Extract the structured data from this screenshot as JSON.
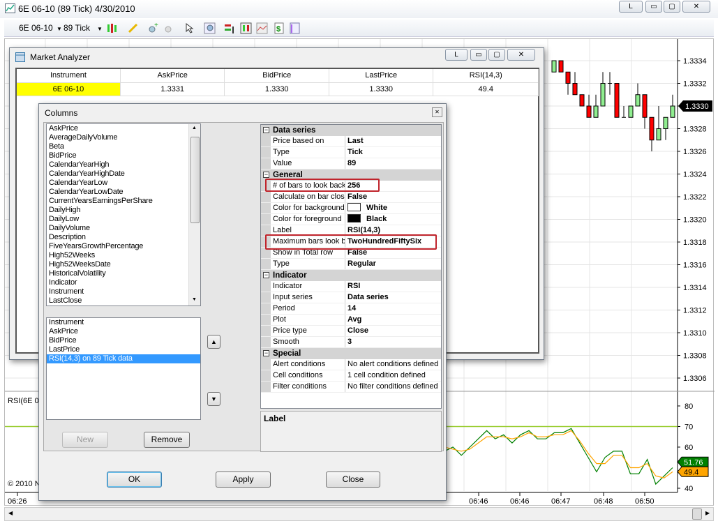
{
  "window": {
    "title": "6E 06-10 (89 Tick)  4/30/2010",
    "controls": [
      "L",
      "▭",
      "▢",
      "✕"
    ]
  },
  "toolbar": {
    "instrument": "6E 06-10",
    "interval": "89 Tick",
    "icons": [
      "chart-style-icon",
      "drawing-tool-icon",
      "zoom-in-icon",
      "zoom-out-icon",
      "pointer-icon",
      "magnifier-icon",
      "data-series-icon",
      "indicators-icon",
      "strategies-icon",
      "order-icon",
      "properties-icon"
    ]
  },
  "chart": {
    "copyright": "© 2010 N",
    "rsi_label": "RSI(6E 0",
    "colors": {
      "up": "#90ee90",
      "down": "#ff0000",
      "rsi": "#008000",
      "avg": "#ffa500",
      "level": "#9acd32"
    },
    "chart_data": [
      {
        "type": "candlestick",
        "price_ticks": [
          "1.3334",
          "1.3332",
          "1.3330",
          "1.3328",
          "1.3326",
          "1.3324",
          "1.3322",
          "1.3320",
          "1.3318",
          "1.3316",
          "1.3314",
          "1.3312",
          "1.3310",
          "1.3308",
          "1.3306"
        ],
        "last_price": "1.3330",
        "ohlc": [
          [
            1.3333,
            1.3334,
            1.3333,
            1.3334
          ],
          [
            1.3334,
            1.3334,
            1.3333,
            1.3333
          ],
          [
            1.3333,
            1.3333,
            1.3331,
            1.3332
          ],
          [
            1.3332,
            1.3333,
            1.3331,
            1.3331
          ],
          [
            1.3331,
            1.3331,
            1.333,
            1.333
          ],
          [
            1.333,
            1.3331,
            1.3329,
            1.3329
          ],
          [
            1.3329,
            1.3331,
            1.3329,
            1.333
          ],
          [
            1.333,
            1.3333,
            1.333,
            1.3332
          ],
          [
            1.3332,
            1.3333,
            1.3331,
            1.3332
          ],
          [
            1.3332,
            1.3332,
            1.3329,
            1.3329
          ],
          [
            1.3329,
            1.333,
            1.3329,
            1.3329
          ],
          [
            1.3329,
            1.333,
            1.3329,
            1.333
          ],
          [
            1.333,
            1.3332,
            1.333,
            1.3331
          ],
          [
            1.3331,
            1.3331,
            1.3328,
            1.3329
          ],
          [
            1.3329,
            1.3329,
            1.3326,
            1.3327
          ],
          [
            1.3327,
            1.333,
            1.3327,
            1.3328
          ],
          [
            1.3328,
            1.3329,
            1.3327,
            1.3329
          ],
          [
            1.3329,
            1.3331,
            1.3329,
            1.333
          ]
        ]
      },
      {
        "type": "line",
        "rsi_ticks": [
          "80",
          "70",
          "60",
          "40"
        ],
        "level": 70,
        "ylim": [
          40,
          80
        ],
        "series": [
          {
            "values": [
              58,
              60,
              56,
              60,
              64,
              68,
              64,
              66,
              62,
              66,
              68,
              64,
              64,
              67,
              67,
              69,
              62,
              55,
              48,
              55,
              58,
              58,
              47,
              47,
              54,
              42,
              46,
              50
            ]
          },
          {
            "values": [
              60,
              59,
              58,
              59,
              62,
              65,
              65,
              65,
              64,
              65,
              67,
              65,
              65,
              66,
              66,
              68,
              63,
              57,
              52,
              52,
              56,
              56,
              50,
              50,
              52,
              46,
              45,
              48
            ]
          }
        ],
        "last_values": [
          "51.76",
          "49.4"
        ]
      }
    ],
    "time_ticks": [
      "06:26",
      "06:46",
      "06:46",
      "06:47",
      "06:48",
      "06:50"
    ]
  },
  "market_analyzer": {
    "title": "Market Analyzer",
    "controls": [
      "L",
      "▭",
      "▢",
      "✕"
    ],
    "columns": [
      "Instrument",
      "AskPrice",
      "BidPrice",
      "LastPrice",
      "RSI(14,3)"
    ],
    "rows": [
      [
        "6E 06-10",
        "1.3331",
        "1.3330",
        "1.3330",
        "49.4"
      ]
    ]
  },
  "columns_dialog": {
    "title": "Columns",
    "close": "✕",
    "available": [
      "AskPrice",
      "AverageDailyVolume",
      "Beta",
      "BidPrice",
      "CalendarYearHigh",
      "CalendarYearHighDate",
      "CalendarYearLow",
      "CalendarYearLowDate",
      "CurrentYearsEarningsPerShare",
      "DailyHigh",
      "DailyLow",
      "DailyVolume",
      "Description",
      "FiveYearsGrowthPercentage",
      "High52Weeks",
      "High52WeeksDate",
      "HistoricalVolatility",
      "Indicator",
      "Instrument",
      "LastClose"
    ],
    "selected": [
      "Instrument",
      "AskPrice",
      "BidPrice",
      "LastPrice",
      "RSI(14,3) on 89 Tick data"
    ],
    "up": "▲",
    "down": "▼",
    "properties": [
      {
        "category": "Data series",
        "rows": [
          [
            "Price based on",
            "Last"
          ],
          [
            "Type",
            "Tick"
          ],
          [
            "Value",
            "89"
          ]
        ]
      },
      {
        "category": "General",
        "rows": [
          [
            "# of bars to look back",
            "256"
          ],
          [
            "Calculate on bar close",
            "False"
          ],
          [
            "Color for background",
            "White"
          ],
          [
            "Color for foreground",
            "Black"
          ],
          [
            "Label",
            "RSI(14,3)"
          ],
          [
            "Maximum bars look back",
            "TwoHundredFiftySix"
          ],
          [
            "Show in Total row",
            "False"
          ],
          [
            "Type",
            "Regular"
          ]
        ]
      },
      {
        "category": "Indicator",
        "rows": [
          [
            "Indicator",
            "RSI"
          ],
          [
            "Input series",
            "Data series"
          ],
          [
            "Period",
            "14"
          ],
          [
            "Plot",
            "Avg"
          ],
          [
            "Price type",
            "Close"
          ],
          [
            "Smooth",
            "3"
          ]
        ]
      },
      {
        "category": "Special",
        "rows": [
          [
            "Alert conditions",
            "No alert conditions defined"
          ],
          [
            "Cell conditions",
            "1 cell condition defined"
          ],
          [
            "Filter conditions",
            "No filter conditions defined"
          ]
        ]
      }
    ],
    "description_title": "Label",
    "buttons": {
      "new": "New",
      "remove": "Remove",
      "ok": "OK",
      "apply": "Apply",
      "close": "Close"
    }
  }
}
